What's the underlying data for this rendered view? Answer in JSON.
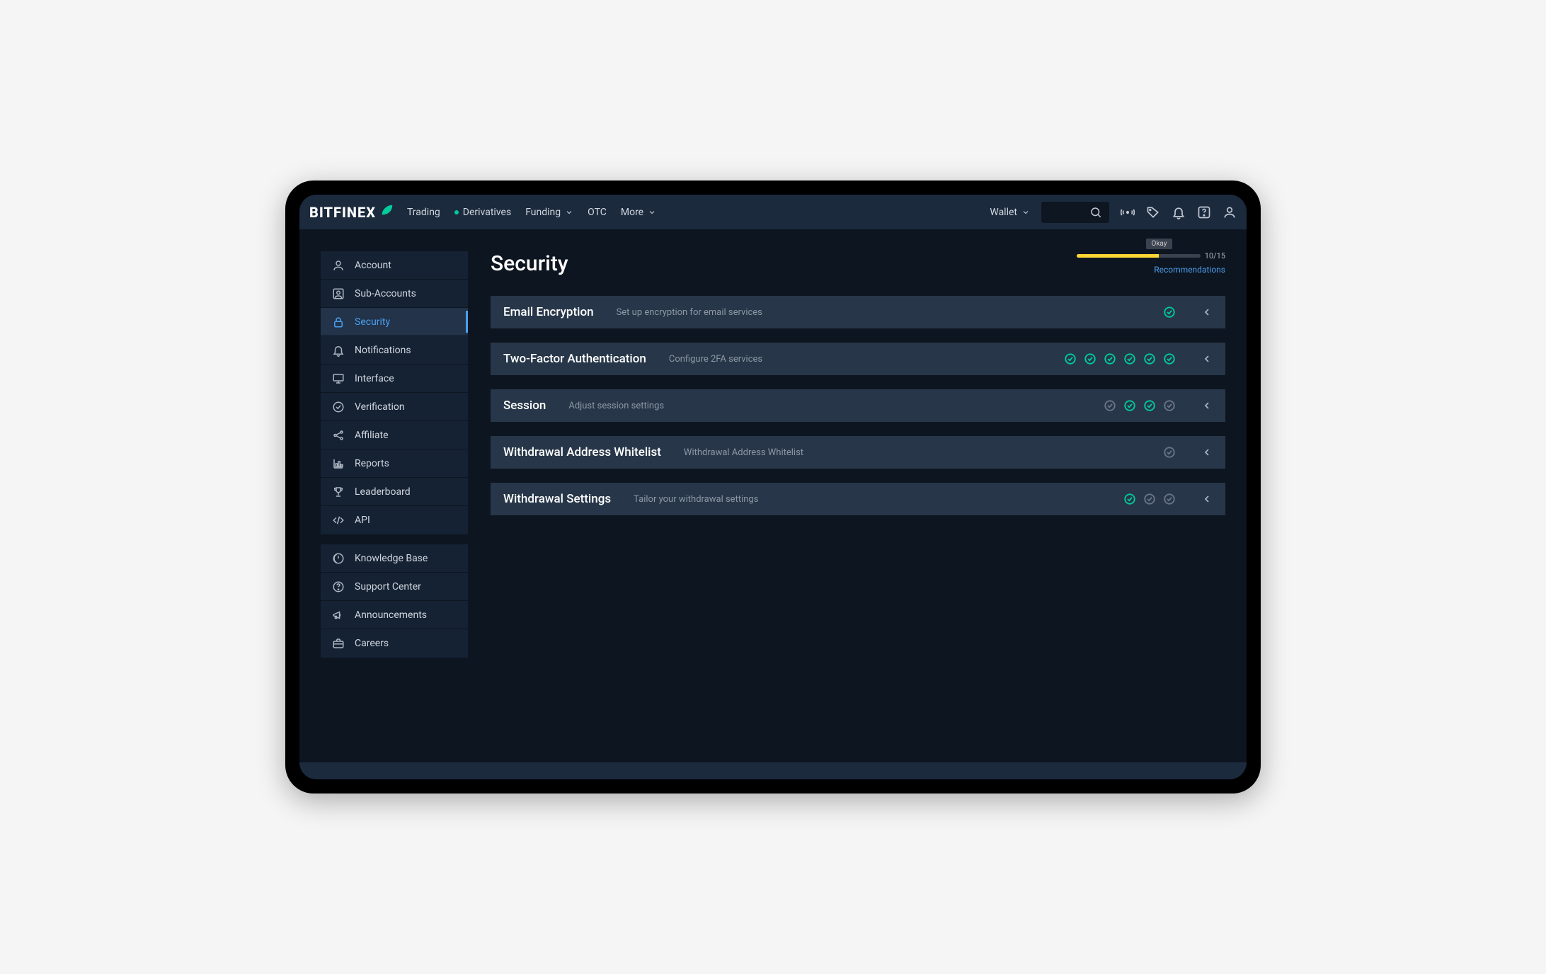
{
  "brand": "BITFINEX",
  "topnav": {
    "items": [
      {
        "label": "Trading",
        "dot": false,
        "chevron": false
      },
      {
        "label": "Derivatives",
        "dot": true,
        "chevron": false
      },
      {
        "label": "Funding",
        "dot": false,
        "chevron": true
      },
      {
        "label": "OTC",
        "dot": false,
        "chevron": false
      },
      {
        "label": "More",
        "dot": false,
        "chevron": true
      }
    ],
    "wallet_label": "Wallet"
  },
  "sidebar": {
    "group1": [
      {
        "label": "Account",
        "icon": "user"
      },
      {
        "label": "Sub-Accounts",
        "icon": "subaccount"
      },
      {
        "label": "Security",
        "icon": "lock",
        "active": true
      },
      {
        "label": "Notifications",
        "icon": "bell"
      },
      {
        "label": "Interface",
        "icon": "monitor"
      },
      {
        "label": "Verification",
        "icon": "check-circle"
      },
      {
        "label": "Affiliate",
        "icon": "share"
      },
      {
        "label": "Reports",
        "icon": "chart"
      },
      {
        "label": "Leaderboard",
        "icon": "trophy"
      },
      {
        "label": "API",
        "icon": "code"
      }
    ],
    "group2": [
      {
        "label": "Knowledge Base",
        "icon": "book"
      },
      {
        "label": "Support Center",
        "icon": "help"
      },
      {
        "label": "Announcements",
        "icon": "megaphone"
      },
      {
        "label": "Careers",
        "icon": "briefcase"
      }
    ]
  },
  "page": {
    "title": "Security",
    "score": {
      "current": 10,
      "total": 15,
      "label": "Okay",
      "text": "10/15",
      "recommendations": "Recommendations"
    },
    "panels": [
      {
        "title": "Email Encryption",
        "subtitle": "Set up encryption for email services",
        "status": [
          "ok"
        ]
      },
      {
        "title": "Two-Factor Authentication",
        "subtitle": "Configure 2FA services",
        "status": [
          "ok",
          "ok",
          "ok",
          "ok",
          "ok",
          "ok"
        ]
      },
      {
        "title": "Session",
        "subtitle": "Adjust session settings",
        "status": [
          "off",
          "ok",
          "ok",
          "off"
        ]
      },
      {
        "title": "Withdrawal Address Whitelist",
        "subtitle": "Withdrawal Address Whitelist",
        "status": [
          "off"
        ]
      },
      {
        "title": "Withdrawal Settings",
        "subtitle": "Tailor your withdrawal settings",
        "status": [
          "ok",
          "off",
          "off"
        ]
      }
    ]
  },
  "colors": {
    "accent": "#4b9fed",
    "success": "#03ca9b",
    "warn": "#fdd835",
    "muted": "#6a7486"
  }
}
